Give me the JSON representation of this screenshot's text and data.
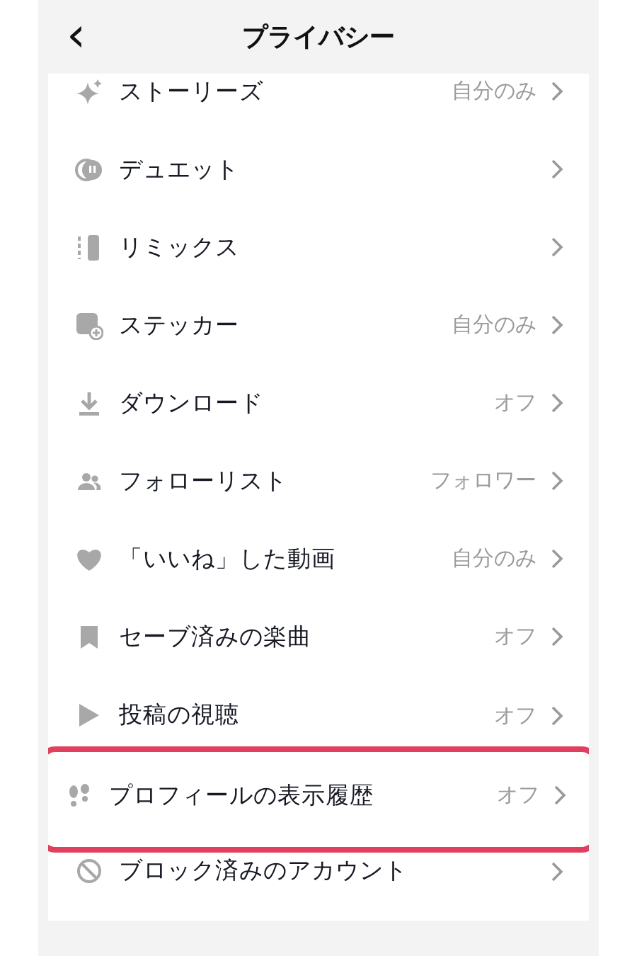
{
  "header": {
    "back": "‹",
    "title": "プライバシー"
  },
  "items": [
    {
      "label": "ストーリーズ",
      "value": "自分のみ",
      "highlighted": false
    },
    {
      "label": "デュエット",
      "highlighted": false
    },
    {
      "label": "リミックス",
      "highlighted": false
    },
    {
      "label": "ステッカー",
      "value": "自分のみ",
      "highlighted": false
    },
    {
      "label": "ダウンロード",
      "value": "オフ",
      "highlighted": false
    },
    {
      "label": "フォローリスト",
      "value": "フォロワー",
      "highlighted": false
    },
    {
      "label": "「いいね」した動画",
      "value": "自分のみ",
      "highlighted": false
    },
    {
      "label": "セーブ済みの楽曲",
      "value": "オフ",
      "highlighted": false
    },
    {
      "label": "投稿の視聴",
      "value": "オフ",
      "highlighted": false
    },
    {
      "label": "プロフィールの表示履歴",
      "value": "オフ",
      "highlighted": true
    },
    {
      "label": "ブロック済みのアカウント",
      "highlighted": false
    }
  ]
}
